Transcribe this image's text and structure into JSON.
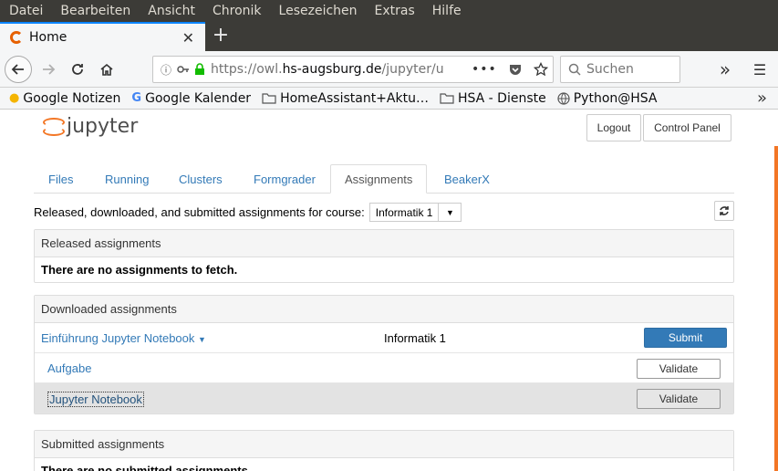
{
  "menu": [
    "Datei",
    "Bearbeiten",
    "Ansicht",
    "Chronik",
    "Lesezeichen",
    "Extras",
    "Hilfe"
  ],
  "browser": {
    "tab_title": "Home",
    "tab_close": "✕",
    "new_tab": "+",
    "url_prefix": "https://owl.",
    "url_domain": "hs-augsburg.de",
    "url_path": "/jupyter/u",
    "search_placeholder": "Suchen",
    "overflow": "»",
    "menu_icon": "☰"
  },
  "bookmarks": [
    {
      "label": "Google Notizen",
      "icon": "bulb-icon"
    },
    {
      "label": "Google Kalender",
      "icon": "google-icon"
    },
    {
      "label": "HomeAssistant+Aktu…",
      "icon": "folder-icon"
    },
    {
      "label": "HSA - Dienste",
      "icon": "folder-icon"
    },
    {
      "label": "Python@HSA",
      "icon": "globe-icon"
    }
  ],
  "jupyter": {
    "logo_text": "jupyter",
    "logout": "Logout",
    "control_panel": "Control Panel",
    "tabs": [
      "Files",
      "Running",
      "Clusters",
      "Formgrader",
      "Assignments",
      "BeakerX"
    ],
    "active_tab": "Assignments",
    "course_label": "Released, downloaded, and submitted assignments for course:",
    "course_value": "Informatik 1",
    "released": {
      "heading": "Released assignments",
      "message": "There are no assignments to fetch."
    },
    "downloaded": {
      "heading": "Downloaded assignments",
      "assignment_name": "Einführung Jupyter Notebook",
      "course": "Informatik 1",
      "submit_label": "Submit",
      "notebooks": [
        {
          "name": "Aufgabe",
          "action": "Validate"
        },
        {
          "name": "Jupyter Notebook",
          "action": "Validate"
        }
      ]
    },
    "submitted": {
      "heading": "Submitted assignments",
      "message": "There are no submitted assignments."
    }
  },
  "colors": {
    "accent": "#337ab7",
    "jupyter_orange": "#f37726",
    "menubar": "#3c3b37"
  }
}
